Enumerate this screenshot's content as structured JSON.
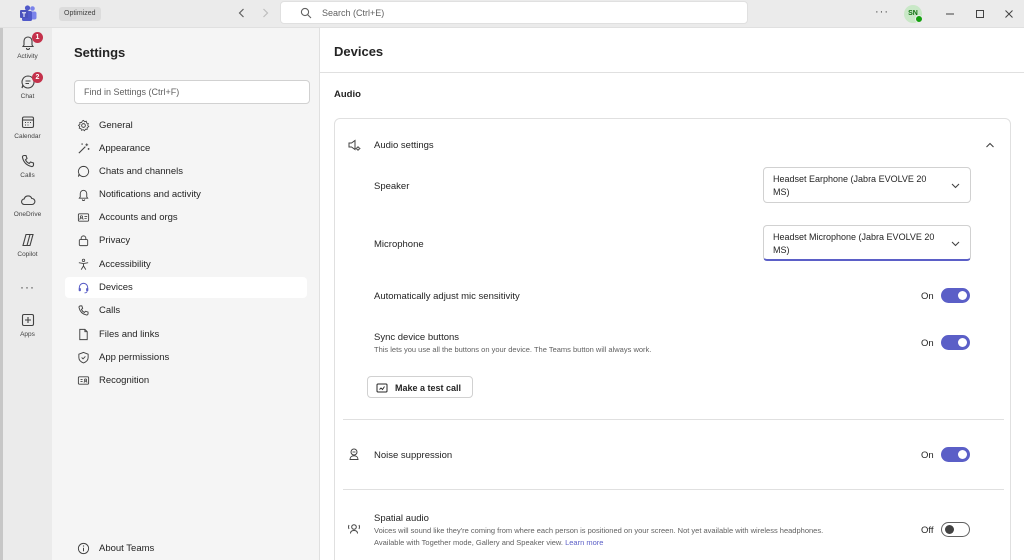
{
  "window": {
    "optimized_label": "Optimized",
    "search_placeholder": "Search (Ctrl+E)",
    "more_label": "···",
    "avatar_initials": "SN"
  },
  "rail": {
    "items": [
      {
        "label": "Activity",
        "badge": "1"
      },
      {
        "label": "Chat",
        "badge": "2"
      },
      {
        "label": "Calendar"
      },
      {
        "label": "Calls"
      },
      {
        "label": "OneDrive"
      },
      {
        "label": "Copilot"
      },
      {
        "label": "Apps"
      }
    ],
    "more_label": "···"
  },
  "settings": {
    "title": "Settings",
    "search_placeholder": "Find in Settings (Ctrl+F)",
    "nav": [
      {
        "label": "General",
        "icon": "gear-icon"
      },
      {
        "label": "Appearance",
        "icon": "wand-icon"
      },
      {
        "label": "Chats and channels",
        "icon": "chat-icon"
      },
      {
        "label": "Notifications and activity",
        "icon": "bell-icon"
      },
      {
        "label": "Accounts and orgs",
        "icon": "id-card-icon"
      },
      {
        "label": "Privacy",
        "icon": "lock-icon"
      },
      {
        "label": "Accessibility",
        "icon": "accessibility-icon"
      },
      {
        "label": "Devices",
        "icon": "headset-icon",
        "selected": true
      },
      {
        "label": "Calls",
        "icon": "phone-icon"
      },
      {
        "label": "Files and links",
        "icon": "document-icon"
      },
      {
        "label": "App permissions",
        "icon": "shield-icon"
      },
      {
        "label": "Recognition",
        "icon": "recognition-icon"
      }
    ],
    "about": "About Teams"
  },
  "main": {
    "title": "Devices",
    "section_title": "Audio",
    "audio_settings": {
      "title": "Audio settings",
      "speaker_label": "Speaker",
      "speaker_value": "Headset Earphone (Jabra EVOLVE 20 MS)",
      "microphone_label": "Microphone",
      "microphone_value": "Headset Microphone (Jabra EVOLVE 20 MS)",
      "auto_adjust_label": "Automatically adjust mic sensitivity",
      "auto_adjust_state": "On",
      "sync_label": "Sync device buttons",
      "sync_desc": "This lets you use all the buttons on your device. The Teams button will always work.",
      "sync_state": "On",
      "test_call_label": "Make a test call"
    },
    "noise": {
      "title": "Noise suppression",
      "state": "On"
    },
    "spatial": {
      "title": "Spatial audio",
      "desc_line1": "Voices will sound like they're coming from where each person is positioned on your screen. Not yet available with wireless headphones.",
      "desc_line2": "Available with Together mode, Gallery and Speaker view.",
      "learn_more": "Learn more",
      "state": "Off"
    }
  },
  "colors": {
    "accent": "#5b5fc7",
    "badge": "#c4314b",
    "presence": "#13a10e",
    "rail_bg": "#ebebeb",
    "nav_bg": "#f5f5f5"
  }
}
